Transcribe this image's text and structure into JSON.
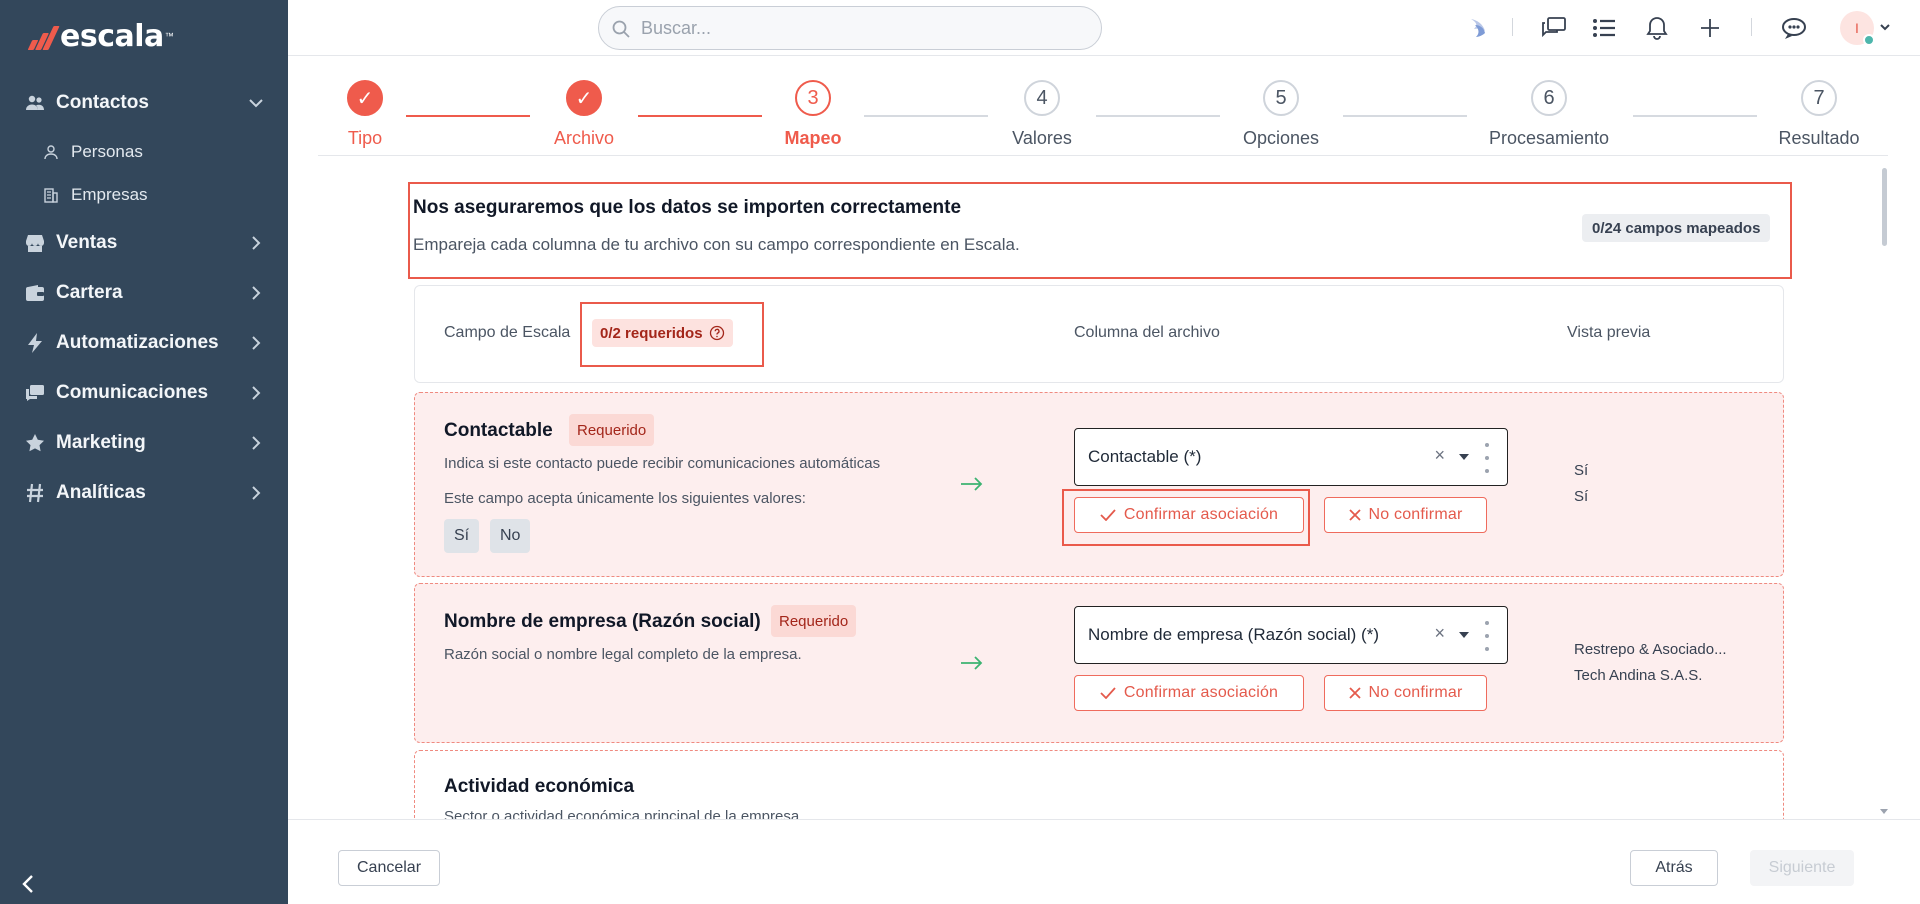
{
  "brand": {
    "name": "escala",
    "tm": "™"
  },
  "sidebar": {
    "items": [
      {
        "label": "Contactos",
        "icon": "users-icon",
        "expanded": true
      },
      {
        "label": "Ventas",
        "icon": "store-icon"
      },
      {
        "label": "Cartera",
        "icon": "wallet-icon"
      },
      {
        "label": "Automatizaciones",
        "icon": "bolt-icon"
      },
      {
        "label": "Comunicaciones",
        "icon": "chat-icon"
      },
      {
        "label": "Marketing",
        "icon": "star-icon"
      },
      {
        "label": "Analíticas",
        "icon": "hash-icon"
      }
    ],
    "subitems": [
      {
        "label": "Personas",
        "icon": "person-icon"
      },
      {
        "label": "Empresas",
        "icon": "building-icon"
      }
    ]
  },
  "topbar": {
    "search_placeholder": "Buscar...",
    "avatar_initial": "I"
  },
  "stepper": {
    "steps": [
      {
        "number": "✓",
        "label": "Tipo",
        "state": "done"
      },
      {
        "number": "✓",
        "label": "Archivo",
        "state": "done"
      },
      {
        "number": "3",
        "label": "Mapeo",
        "state": "active"
      },
      {
        "number": "4",
        "label": "Valores",
        "state": "pending"
      },
      {
        "number": "5",
        "label": "Opciones",
        "state": "pending"
      },
      {
        "number": "6",
        "label": "Procesamiento",
        "state": "pending"
      },
      {
        "number": "7",
        "label": "Resultado",
        "state": "pending"
      }
    ]
  },
  "header": {
    "title": "Nos aseguraremos que los datos se importen correctamente",
    "subtitle": "Empareja cada columna de tu archivo con su campo correspondiente en Escala.",
    "mapped_badge": "0/24 campos mapeados"
  },
  "columns": {
    "field": "Campo de Escala",
    "required_badge": "0/2 requeridos",
    "file_column": "Columna del archivo",
    "preview": "Vista previa"
  },
  "rows": [
    {
      "title": "Contactable",
      "required_tag": "Requerido",
      "description": "Indica si este contacto puede recibir comunicaciones automáticas",
      "accepts_text": "Este campo acepta únicamente los siguientes valores:",
      "values": [
        "Sí",
        "No"
      ],
      "select_value": "Contactable (*)",
      "confirm_label": "Confirmar asociación",
      "reject_label": "No confirmar",
      "preview": [
        "Sí",
        "Sí"
      ]
    },
    {
      "title": "Nombre de empresa (Razón social)",
      "required_tag": "Requerido",
      "description": "Razón social o nombre legal completo de la empresa.",
      "select_value": "Nombre de empresa (Razón social) (*)",
      "confirm_label": "Confirmar asociación",
      "reject_label": "No confirmar",
      "preview": [
        "Restrepo & Asociado...",
        "Tech Andina S.A.S."
      ]
    },
    {
      "title": "Actividad económica",
      "description": "Sector o actividad económica principal de la empresa."
    }
  ],
  "footer": {
    "cancel": "Cancelar",
    "back": "Atrás",
    "next": "Siguiente"
  },
  "colors": {
    "sidebar_bg": "#33475b",
    "accent": "#ef5b4c",
    "required_bg": "#fbd9d5",
    "row_bg": "#fdeeee"
  }
}
